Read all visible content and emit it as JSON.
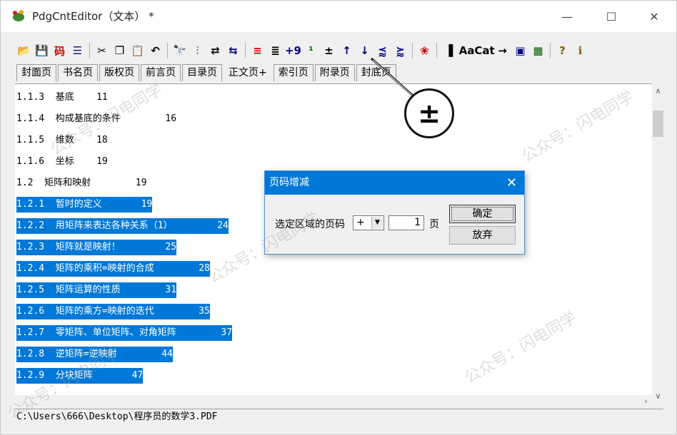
{
  "window": {
    "title": "PdgCntEditor（文本） *",
    "minimize_glyph": "—",
    "maximize_glyph": "☐",
    "close_glyph": "✕"
  },
  "toolbar": {
    "items": [
      {
        "icon": "open-folder-icon",
        "glyph": "📂",
        "color": "#c08000"
      },
      {
        "icon": "save-icon",
        "glyph": "💾",
        "color": "#000000"
      },
      {
        "icon": "code-icon",
        "glyph": "码",
        "color": "#d00000"
      },
      {
        "icon": "outline-icon",
        "glyph": "☰",
        "color": "#1a1a80"
      },
      {
        "sep": true
      },
      {
        "icon": "cut-icon",
        "glyph": "✂",
        "color": "#000000"
      },
      {
        "icon": "copy-icon",
        "glyph": "❐",
        "color": "#000000"
      },
      {
        "icon": "paste-icon",
        "glyph": "📋",
        "color": "#806000"
      },
      {
        "icon": "undo-icon",
        "glyph": "↶",
        "color": "#000000"
      },
      {
        "sep": true
      },
      {
        "icon": "find-icon",
        "glyph": "🔭",
        "color": "#000000"
      },
      {
        "icon": "find-next-icon",
        "glyph": "⫶",
        "color": "#808080"
      },
      {
        "icon": "replace-icon",
        "glyph": "⇄",
        "color": "#000000"
      },
      {
        "icon": "replace-all-icon",
        "glyph": "⇆",
        "color": "#000080"
      },
      {
        "sep": true
      },
      {
        "icon": "indent-icon",
        "glyph": "≡",
        "color": "#d00000"
      },
      {
        "icon": "outdent-icon",
        "glyph": "≣",
        "color": "#000000"
      },
      {
        "icon": "page-number-icon",
        "glyph": "+9",
        "color": "#000080"
      },
      {
        "icon": "page-sequence-icon",
        "glyph": "¹",
        "color": "#007000"
      },
      {
        "icon": "page-adjust-icon",
        "glyph": "±",
        "color": "#000000"
      },
      {
        "icon": "level-up-icon",
        "glyph": "↑",
        "color": "#000080"
      },
      {
        "icon": "level-down-icon",
        "glyph": "↓",
        "color": "#000080"
      },
      {
        "icon": "merge-icon",
        "glyph": "⪷",
        "color": "#000080"
      },
      {
        "icon": "split-icon",
        "glyph": "⪸",
        "color": "#000080"
      },
      {
        "sep": true
      },
      {
        "icon": "pdf-icon",
        "glyph": "❀",
        "color": "#d00000"
      },
      {
        "sep": true
      },
      {
        "icon": "columns-icon",
        "glyph": "▐",
        "color": "#000000"
      },
      {
        "icon": "font-icon",
        "glyph": "Aa",
        "color": "#000000"
      },
      {
        "icon": "cat-icon",
        "glyph": "Cat",
        "color": "#000000"
      },
      {
        "icon": "pin-icon",
        "glyph": "→",
        "color": "#000000"
      },
      {
        "icon": "window-icon",
        "glyph": "▣",
        "color": "#000080"
      },
      {
        "icon": "preview-icon",
        "glyph": "▦",
        "color": "#006000"
      },
      {
        "sep": true
      },
      {
        "icon": "help-icon",
        "glyph": "?",
        "color": "#806000"
      },
      {
        "icon": "info-icon",
        "glyph": "ℹ",
        "color": "#806000"
      }
    ]
  },
  "tabs": [
    {
      "label": "封面页",
      "active": false
    },
    {
      "label": "书名页",
      "active": false
    },
    {
      "label": "版权页",
      "active": false
    },
    {
      "label": "前言页",
      "active": false
    },
    {
      "label": "目录页",
      "active": false
    },
    {
      "label": "正文页+",
      "active": true
    },
    {
      "label": "索引页",
      "active": false
    },
    {
      "label": "附录页",
      "active": false
    },
    {
      "label": "封底页",
      "active": false
    }
  ],
  "editor_lines": [
    {
      "text": "1.1.3  基底    11",
      "selected": false
    },
    {
      "text": "1.1.4  构成基底的条件        16",
      "selected": false
    },
    {
      "text": "1.1.5  维数    18",
      "selected": false
    },
    {
      "text": "1.1.6  坐标    19",
      "selected": false
    },
    {
      "text": "1.2  矩阵和映射        19",
      "selected": false
    },
    {
      "text": "1.2.1  暂时的定义       19",
      "selected": true
    },
    {
      "text": "1.2.2  用矩阵来表达各种关系（1）        24",
      "selected": true
    },
    {
      "text": "1.2.3  矩阵就是映射！        25",
      "selected": true
    },
    {
      "text": "1.2.4  矩阵的乘积=映射的合成        28",
      "selected": true
    },
    {
      "text": "1.2.5  矩阵运算的性质        31",
      "selected": true
    },
    {
      "text": "1.2.6  矩阵的乘方=映射的迭代        35",
      "selected": true
    },
    {
      "text": "1.2.7  零矩阵、单位矩阵、对角矩阵        37",
      "selected": true
    },
    {
      "text": "1.2.8  逆矩阵=逆映射        44",
      "selected": true
    },
    {
      "text": "1.2.9  分块矩阵       47",
      "selected": true
    }
  ],
  "statusbar": {
    "path": "C:\\Users\\666\\Desktop\\程序员的数学3.PDF"
  },
  "dialog": {
    "title": "页码增减",
    "close_glyph": "✕",
    "label": "选定区域的页码",
    "operator_value": "+",
    "amount_value": "1",
    "unit": "页",
    "ok_label": "确定",
    "cancel_label": "放弃"
  },
  "callout": {
    "glyph": "±"
  },
  "watermark": {
    "text": "公众号：闪电同学"
  },
  "colors": {
    "selection": "#0078d7",
    "dialog_title": "#0078d7"
  }
}
